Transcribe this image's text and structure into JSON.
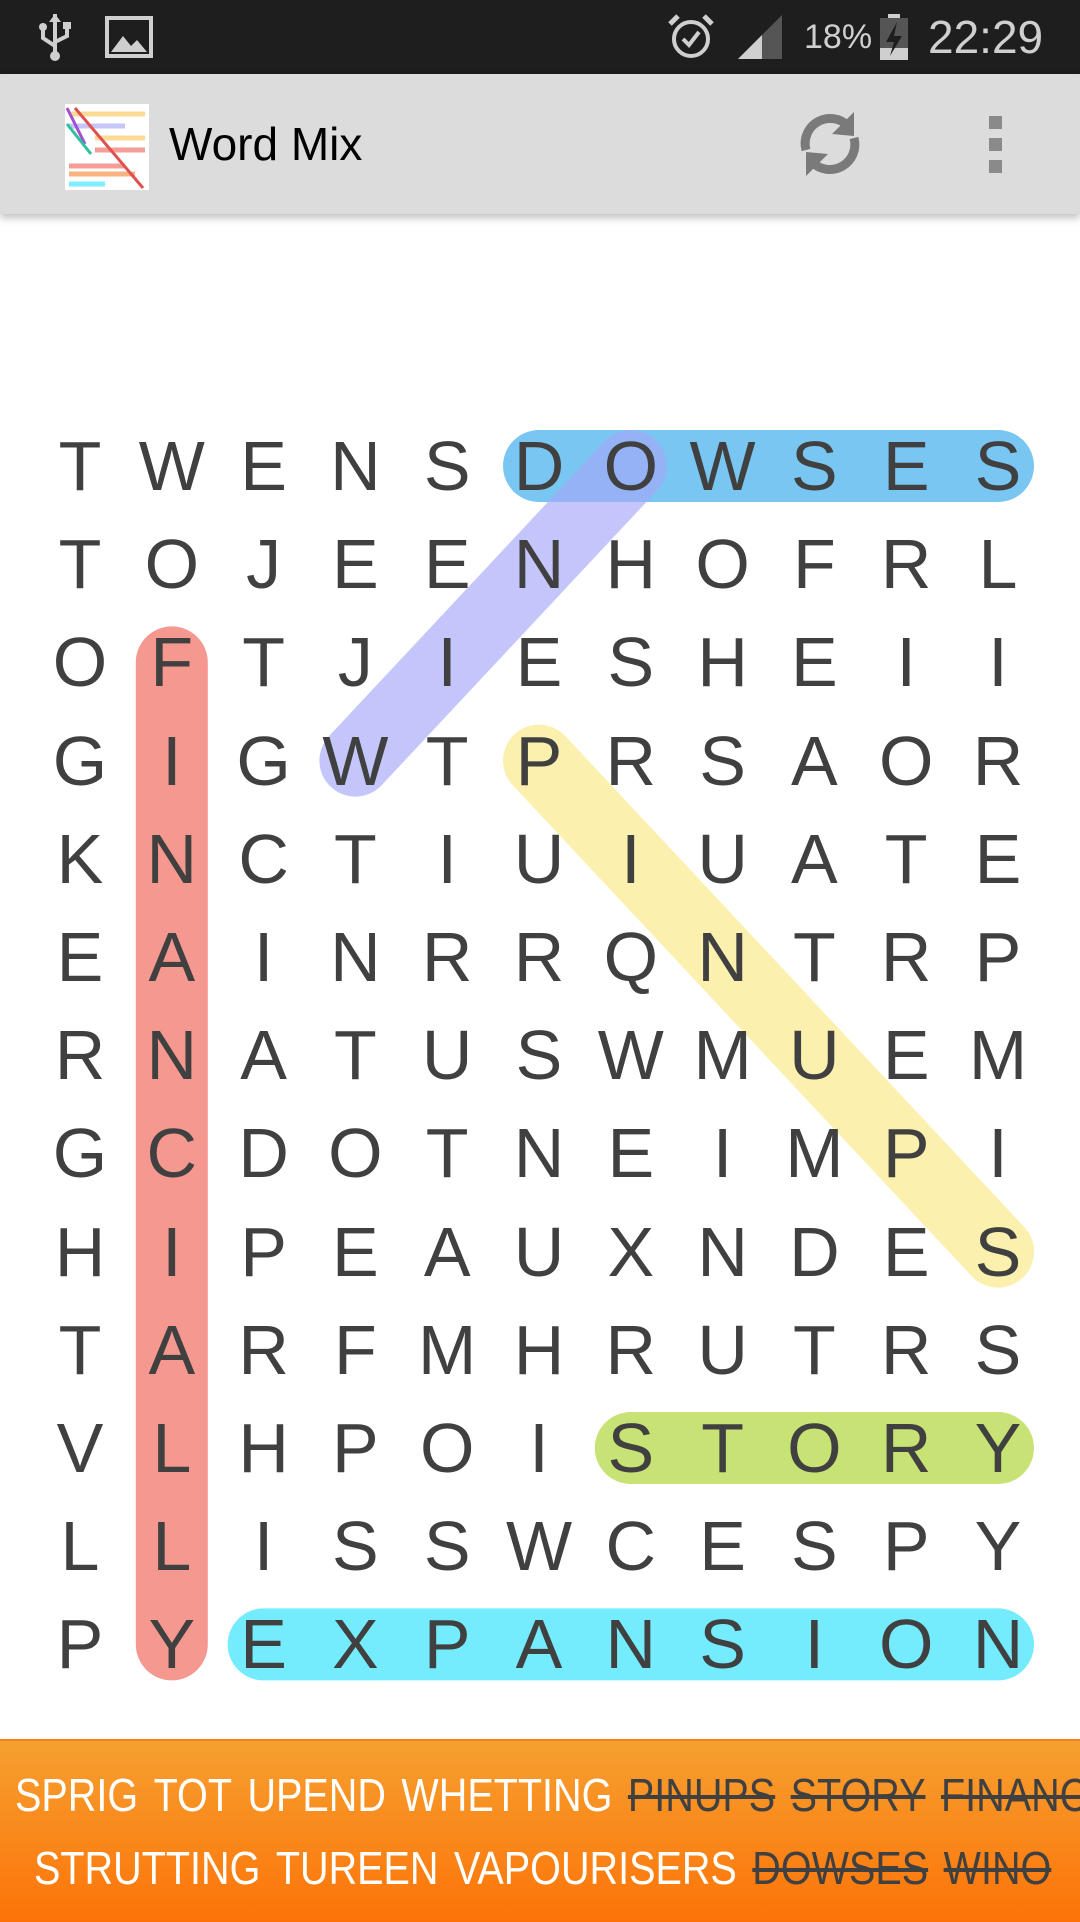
{
  "status_bar": {
    "battery": "18%",
    "time": "22:29",
    "icons": [
      "usb-icon",
      "image-icon",
      "alarm-icon",
      "signal-icon",
      "battery-charging-icon"
    ]
  },
  "app_bar": {
    "title": "Word Mix",
    "actions": [
      "refresh-icon",
      "overflow-menu-icon"
    ]
  },
  "grid": {
    "rows": [
      "TWENSDOWSES",
      "TOJEENHOFRL",
      "OFTJIESHEII",
      "GIGWTPRSAOR",
      "KNCTIUIUATE",
      "EAINRRQNTRP",
      "RNATUSWMUEM",
      "GCDOTNEIMPI",
      "HIPEAUXNDES",
      "TARFMHRUTRS",
      "VLHPOISTORY",
      "LLISSWCESPY",
      "PYEXPANSION"
    ],
    "found": [
      {
        "word": "DOWSES",
        "from": [
          0,
          5
        ],
        "to": [
          0,
          10
        ],
        "color": "#63bdf2"
      },
      {
        "word": "WINO",
        "from": [
          3,
          3
        ],
        "to": [
          0,
          6
        ],
        "color": "#a5a8fa"
      },
      {
        "word": "FINANCIALLY",
        "from": [
          2,
          1
        ],
        "to": [
          12,
          1
        ],
        "color": "#f4877c"
      },
      {
        "word": "PINUPS",
        "from": [
          3,
          5
        ],
        "to": [
          8,
          10
        ],
        "color": "#fbeea0"
      },
      {
        "word": "STORY",
        "from": [
          10,
          6
        ],
        "to": [
          10,
          10
        ],
        "color": "#bedd5e"
      },
      {
        "word": "EXPANSION",
        "from": [
          12,
          2
        ],
        "to": [
          12,
          10
        ],
        "color": "#5ee9fd"
      }
    ]
  },
  "word_list": {
    "lines": [
      [
        {
          "text": "SPRIG",
          "found": false
        },
        {
          "text": "TOT",
          "found": false
        },
        {
          "text": "UPEND",
          "found": false
        },
        {
          "text": "WHETTING",
          "found": false
        },
        {
          "text": "PINUPS",
          "found": true
        },
        {
          "text": "STORY",
          "found": true
        },
        {
          "text": "FINANCIALLY",
          "found": true
        }
      ],
      [
        {
          "text": "STRUTTING",
          "found": false
        },
        {
          "text": "TUREEN",
          "found": false
        },
        {
          "text": "VAPOURISERS",
          "found": false
        },
        {
          "text": "DOWSES",
          "found": true
        },
        {
          "text": "WINO",
          "found": true
        }
      ]
    ]
  }
}
